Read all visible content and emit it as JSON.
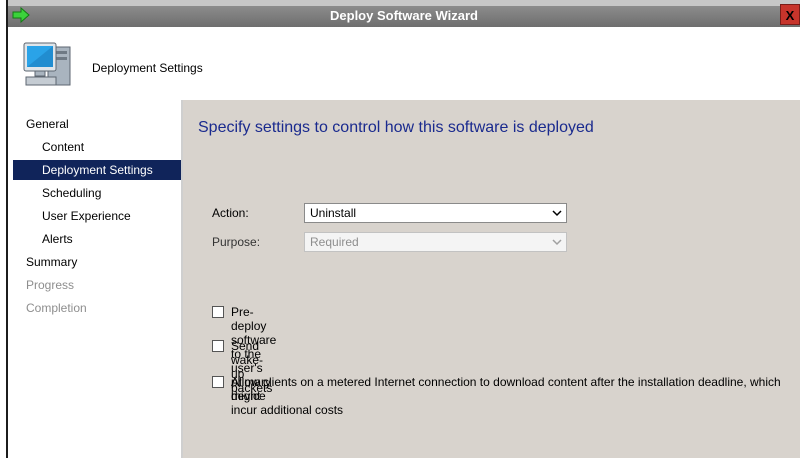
{
  "window": {
    "title": "Deploy Software Wizard",
    "close_label": "X"
  },
  "header": {
    "title": "Deployment Settings"
  },
  "sidebar": {
    "items": [
      {
        "label": "General"
      },
      {
        "label": "Content"
      },
      {
        "label": "Deployment Settings"
      },
      {
        "label": "Scheduling"
      },
      {
        "label": "User Experience"
      },
      {
        "label": "Alerts"
      },
      {
        "label": "Summary"
      },
      {
        "label": "Progress"
      },
      {
        "label": "Completion"
      }
    ],
    "selected": "Deployment Settings"
  },
  "main": {
    "heading": "Specify settings to control how this software is deployed",
    "action": {
      "label": "Action:",
      "value": "Uninstall"
    },
    "purpose": {
      "label": "Purpose:",
      "value": "Required",
      "disabled": true
    },
    "checkboxes": [
      {
        "label": "Pre-deploy software to the user's primary device",
        "checked": false
      },
      {
        "label": "Send wake-up packets",
        "checked": false
      },
      {
        "label": "Allow clients on a metered Internet connection to download content after the installation deadline, which might",
        "label2": "incur additional costs",
        "checked": false
      }
    ]
  },
  "colors": {
    "selected_bg": "#10245a",
    "heading": "#1a2a8e",
    "panel_bg": "#d8d3cd",
    "close": "#c7342b"
  },
  "icons": {
    "app": "green-arrow-icon",
    "header": "computer-icon",
    "dropdown": "chevron-down-icon"
  }
}
